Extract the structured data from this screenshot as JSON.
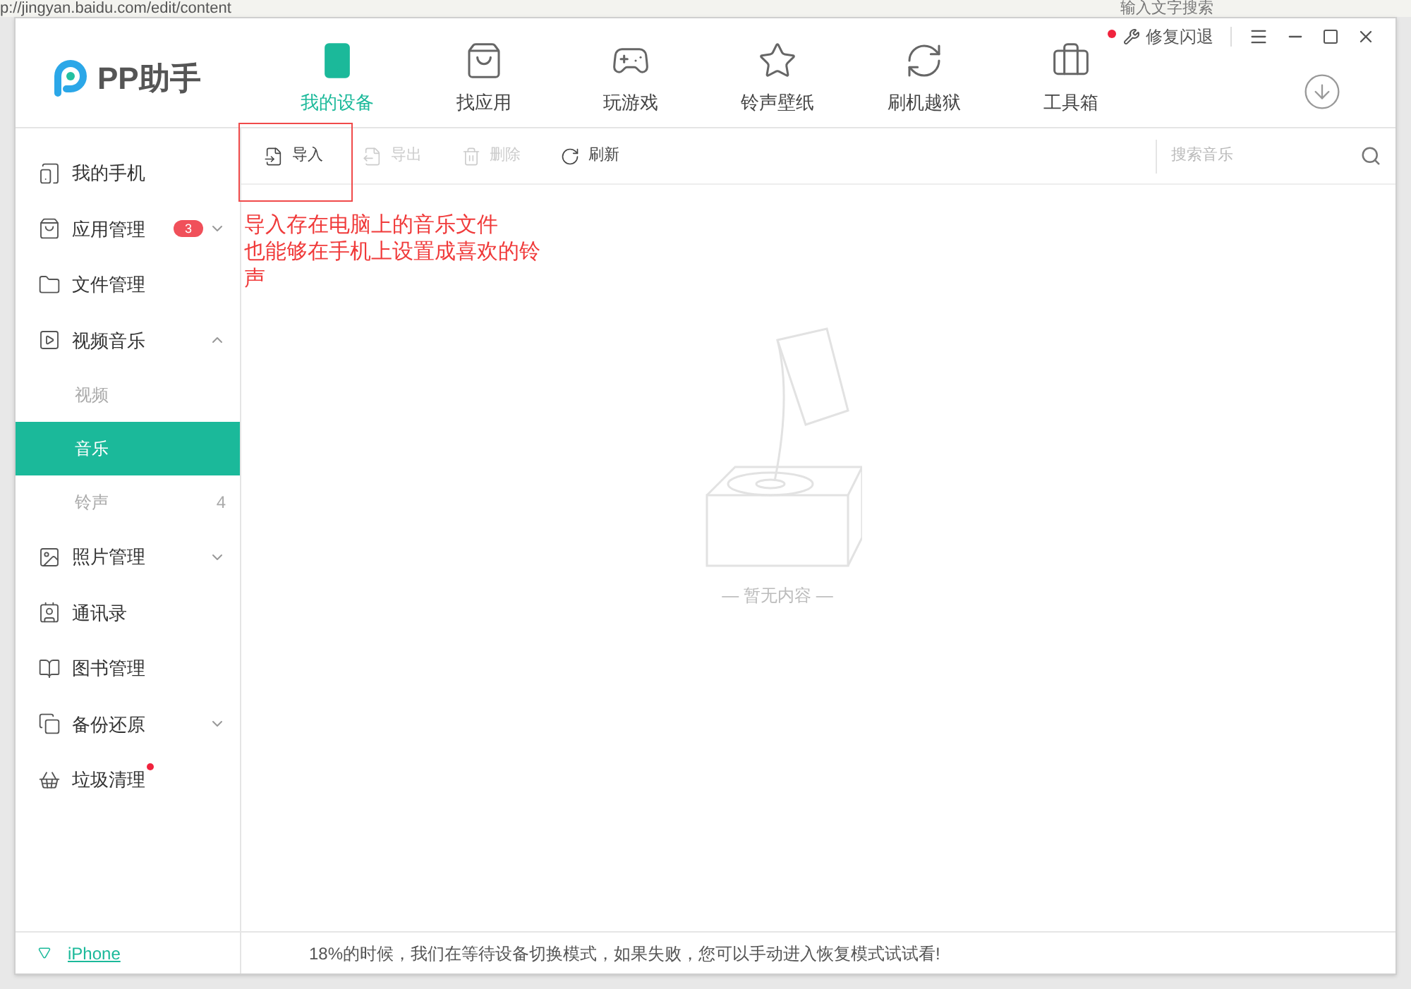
{
  "browser": {
    "url": "p://jingyan.baidu.com/edit/content",
    "search_placeholder": "输入文字搜索"
  },
  "app": {
    "logo": "PP助手",
    "nav": [
      {
        "label": "我的设备",
        "kind": "device",
        "selected": true,
        "dot": false
      },
      {
        "label": "找应用",
        "kind": "apps",
        "selected": false,
        "dot": false
      },
      {
        "label": "玩游戏",
        "kind": "games",
        "selected": false,
        "dot": false
      },
      {
        "label": "铃声壁纸",
        "kind": "star",
        "selected": false,
        "dot": false
      },
      {
        "label": "刷机越狱",
        "kind": "refresh",
        "selected": false,
        "dot": false
      },
      {
        "label": "工具箱",
        "kind": "toolbox",
        "selected": false,
        "dot": true
      }
    ],
    "repair": "修复闪退"
  },
  "sidebar": {
    "items": [
      {
        "label": "我的手机",
        "kind": "phone"
      },
      {
        "label": "应用管理",
        "kind": "bag",
        "badge": "3",
        "expanded": false
      },
      {
        "label": "文件管理",
        "kind": "folder"
      },
      {
        "label": "视频音乐",
        "kind": "play",
        "expanded": true,
        "children": [
          {
            "label": "视频",
            "selected": false
          },
          {
            "label": "音乐",
            "selected": true
          },
          {
            "label": "铃声",
            "selected": false,
            "count": "4"
          }
        ]
      },
      {
        "label": "照片管理",
        "kind": "image",
        "expanded": false
      },
      {
        "label": "通讯录",
        "kind": "contact"
      },
      {
        "label": "图书管理",
        "kind": "book"
      },
      {
        "label": "备份还原",
        "kind": "copy",
        "expanded": false
      },
      {
        "label": "垃圾清理",
        "kind": "basket",
        "dot": true
      }
    ],
    "device": "iPhone"
  },
  "toolbar": {
    "buttons": [
      {
        "label": "导入",
        "kind": "import",
        "disabled": false
      },
      {
        "label": "导出",
        "kind": "export",
        "disabled": true
      },
      {
        "label": "删除",
        "kind": "delete",
        "disabled": true
      },
      {
        "label": "刷新",
        "kind": "refresh",
        "disabled": false
      }
    ],
    "search_placeholder": "搜索音乐"
  },
  "annotation": [
    "导入存在电脑上的音乐文件",
    "也能够在手机上设置成喜欢的铃声"
  ],
  "empty_text": "— 暂无内容 —",
  "status": "18%的时候，我们在等待设备切换模式，如果失败，您可以手动进入恢复模式试试看!"
}
